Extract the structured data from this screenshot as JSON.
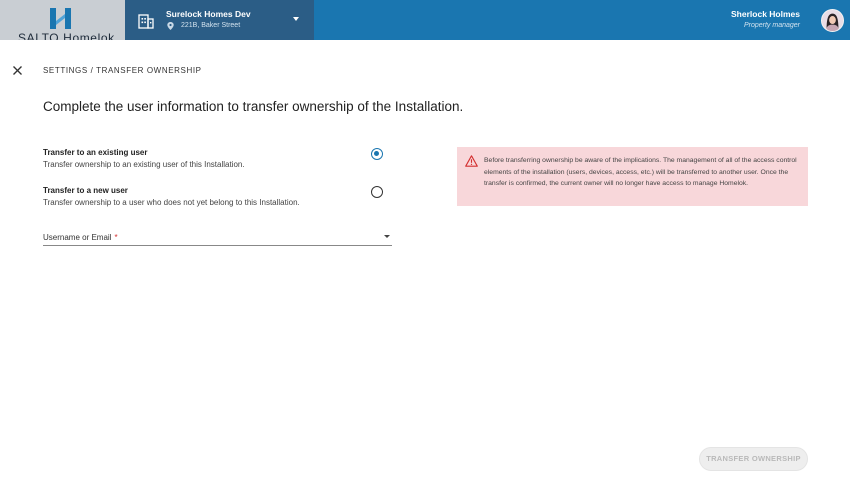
{
  "header": {
    "logo_text": "SALTO Homelok",
    "site": {
      "name": "Surelock Homes Dev",
      "address": "221B, Baker Street"
    },
    "user": {
      "name": "Sherlock Holmes",
      "role": "Property manager"
    }
  },
  "page": {
    "breadcrumb": "SETTINGS / TRANSFER OWNERSHIP",
    "title": "Complete the user information to transfer ownership of the Installation."
  },
  "options": [
    {
      "title": "Transfer to an existing user",
      "description": "Transfer ownership to an existing user of this Installation.",
      "selected": true
    },
    {
      "title": "Transfer to a new user",
      "description": "Transfer ownership to a user who does not yet belong to this Installation.",
      "selected": false
    }
  ],
  "user_field": {
    "label": "Username or Email",
    "required_mark": "*",
    "value": ""
  },
  "warning": {
    "text": "Before transferring ownership be aware of the implications. The management of all of the access control elements of the installation (users, devices, access, etc.) will be transferred to another user. Once the transfer is confirmed, the current owner will no longer have access to manage Homelok."
  },
  "actions": {
    "transfer_label": "TRANSFER OWNERSHIP",
    "transfer_enabled": false
  },
  "colors": {
    "header_bg": "#1a76b0",
    "site_bg": "#2b5d86",
    "logo_bg": "#c9ced3",
    "accent": "#1a76b0",
    "warning_bg": "#f8d7da",
    "warning_icon": "#d32f2f",
    "required": "#d32f2f"
  },
  "icons": {
    "logo": "homelok-logo-icon",
    "site": "building-icon",
    "address": "location-pin-icon",
    "site_dropdown": "chevron-down-icon",
    "close": "close-icon",
    "warning": "warning-triangle-icon",
    "field_dropdown": "dropdown-arrow-icon"
  }
}
